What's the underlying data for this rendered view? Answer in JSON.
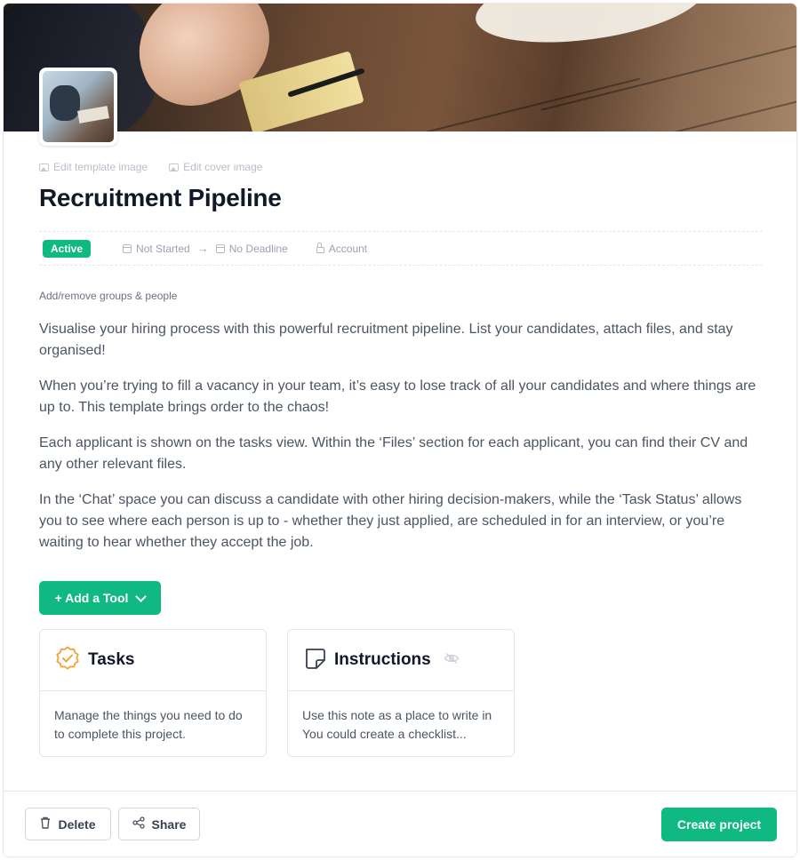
{
  "cover": {
    "edit_template_image": "Edit template image",
    "edit_cover_image": "Edit cover image"
  },
  "project": {
    "title": "Recruitment Pipeline",
    "status_badge": "Active",
    "start": "Not Started",
    "deadline": "No Deadline",
    "access": "Account",
    "groups_link": "Add/remove groups & people"
  },
  "description": [
    "Visualise your hiring process with this powerful recruitment pipeline. List your candidates, attach files, and stay organised!",
    "When you’re trying to fill a vacancy in your team, it’s easy to lose track of all your candidates and where things are up to. This template brings order to the chaos!",
    "Each applicant is shown on the tasks view. Within the ‘Files’ section for each applicant, you can find their CV and any other relevant files.",
    "In the ‘Chat’ space you can discuss a candidate with other hiring decision-makers, while the ‘Task Status’ allows you to see where each person is up to - whether they just applied, are scheduled in for an interview, or you’re waiting to hear whether they accept the job."
  ],
  "tools": {
    "add_label": "+ Add a Tool",
    "cards": [
      {
        "name": "Tasks",
        "icon": "badge-check-icon",
        "text": "Manage the things you need to do to complete this project."
      },
      {
        "name": "Instructions",
        "icon": "sticky-note-icon",
        "text": "Use this note as a place to write in You could create a checklist..."
      }
    ]
  },
  "footer": {
    "delete_label": "Delete",
    "share_label": "Share",
    "create_label": "Create project"
  },
  "colors": {
    "accent": "#10b981",
    "tasks_icon": "#f0a43a"
  }
}
